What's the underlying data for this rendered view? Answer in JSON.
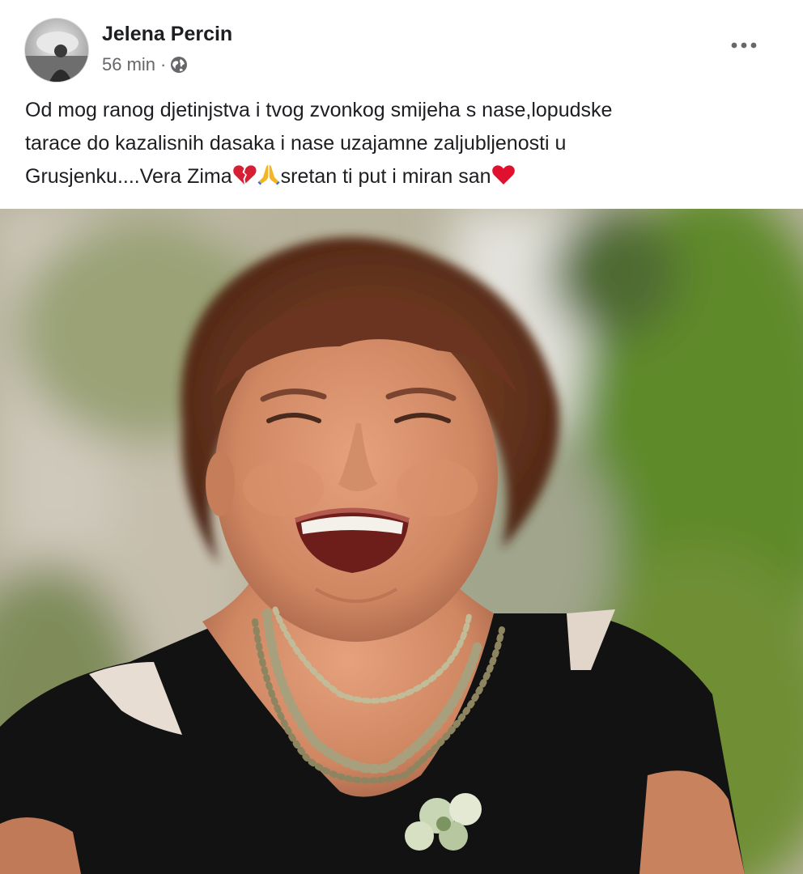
{
  "post": {
    "author": "Jelena Percin",
    "time": "56 min",
    "separator": "·",
    "privacy_icon": "globe-icon",
    "more_icon": "more-horizontal-icon",
    "text_lines": [
      "Od mog ranog djetinjstva i tvog zvonkog smijeha s nase,lopudske",
      "tarace do kazalisnih dasaka i nase uzajamne zaljubljenosti u",
      "Grusjenku....Vera Zima"
    ],
    "text_tail_1": "sretan ti put i miran san",
    "emojis": [
      "broken-heart-icon",
      "folded-hands-icon",
      "red-heart-icon"
    ]
  },
  "photo": {
    "subject": "smiling woman with short auburn hair, black top and beaded necklace, green foliage background"
  },
  "colors": {
    "text": "#1c1e21",
    "secondary": "#65676b",
    "heart": "#e0245e"
  }
}
